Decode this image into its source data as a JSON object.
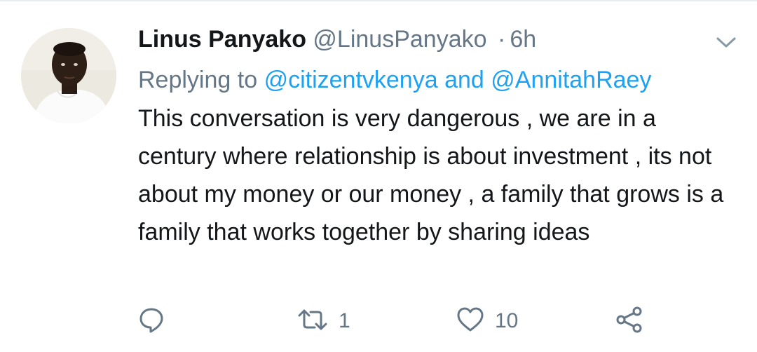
{
  "tweet": {
    "display_name": "Linus Panyako",
    "handle": "@LinusPanyako",
    "separator": "·",
    "time": "6h",
    "reply_prefix": "Replying to",
    "reply_mention_1": "@citizentvkenya",
    "reply_and": "and",
    "reply_mention_2": "@AnnitahRaey",
    "text": "This conversation is very dangerous , we are in a century where relationship is about investment , its not about my money or our money , a family that grows is a family that works together by sharing ideas",
    "retweet_count": "1",
    "like_count": "10"
  },
  "icons": {
    "menu": "chevron-down-icon",
    "reply": "reply-icon",
    "retweet": "retweet-icon",
    "like": "heart-icon",
    "share": "share-icon"
  },
  "colors": {
    "text_primary": "#14171a",
    "text_secondary": "#657786",
    "link": "#1da1f2",
    "icon": "#657786",
    "divider": "#e6ecf0"
  }
}
